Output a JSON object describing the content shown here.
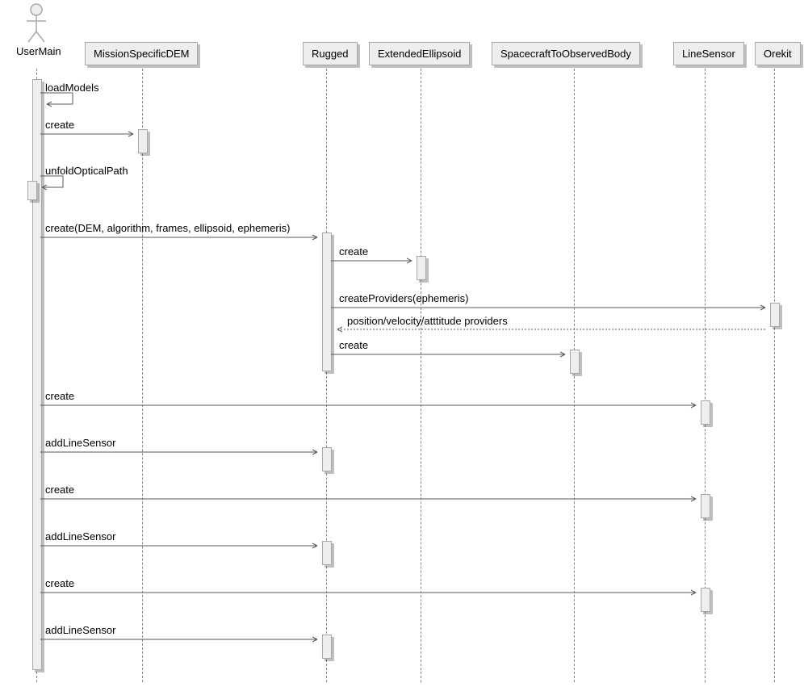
{
  "actor": {
    "label": "UserMain"
  },
  "participants": {
    "dem": "MissionSpecificDEM",
    "rugged": "Rugged",
    "ellipsoid": "ExtendedEllipsoid",
    "sc2ob": "SpacecraftToObservedBody",
    "linesensor": "LineSensor",
    "orekit": "Orekit"
  },
  "messages": {
    "loadModels": "loadModels",
    "create": "create",
    "unfoldOpticalPath": "unfoldOpticalPath",
    "createDEM": "create(DEM, algorithm, frames, ellipsoid, ephemeris)",
    "createProviders": "createProviders(ephemeris)",
    "providersReturn": "position/velocity/atttitude providers",
    "addLineSensor": "addLineSensor"
  },
  "chart_data": {
    "type": "sequence-diagram",
    "actors": [
      "UserMain"
    ],
    "participants": [
      "MissionSpecificDEM",
      "Rugged",
      "ExtendedEllipsoid",
      "SpacecraftToObservedBody",
      "LineSensor",
      "Orekit"
    ],
    "interactions": [
      {
        "from": "UserMain",
        "to": "UserMain",
        "label": "loadModels",
        "type": "self"
      },
      {
        "from": "UserMain",
        "to": "MissionSpecificDEM",
        "label": "create",
        "type": "call"
      },
      {
        "from": "UserMain",
        "to": "UserMain",
        "label": "unfoldOpticalPath",
        "type": "self"
      },
      {
        "from": "UserMain",
        "to": "Rugged",
        "label": "create(DEM, algorithm, frames, ellipsoid, ephemeris)",
        "type": "call"
      },
      {
        "from": "Rugged",
        "to": "ExtendedEllipsoid",
        "label": "create",
        "type": "call"
      },
      {
        "from": "Rugged",
        "to": "Orekit",
        "label": "createProviders(ephemeris)",
        "type": "call"
      },
      {
        "from": "Orekit",
        "to": "Rugged",
        "label": "position/velocity/atttitude providers",
        "type": "return"
      },
      {
        "from": "Rugged",
        "to": "SpacecraftToObservedBody",
        "label": "create",
        "type": "call"
      },
      {
        "from": "UserMain",
        "to": "LineSensor",
        "label": "create",
        "type": "call"
      },
      {
        "from": "UserMain",
        "to": "Rugged",
        "label": "addLineSensor",
        "type": "call"
      },
      {
        "from": "UserMain",
        "to": "LineSensor",
        "label": "create",
        "type": "call"
      },
      {
        "from": "UserMain",
        "to": "Rugged",
        "label": "addLineSensor",
        "type": "call"
      },
      {
        "from": "UserMain",
        "to": "LineSensor",
        "label": "create",
        "type": "call"
      },
      {
        "from": "UserMain",
        "to": "Rugged",
        "label": "addLineSensor",
        "type": "call"
      }
    ]
  }
}
